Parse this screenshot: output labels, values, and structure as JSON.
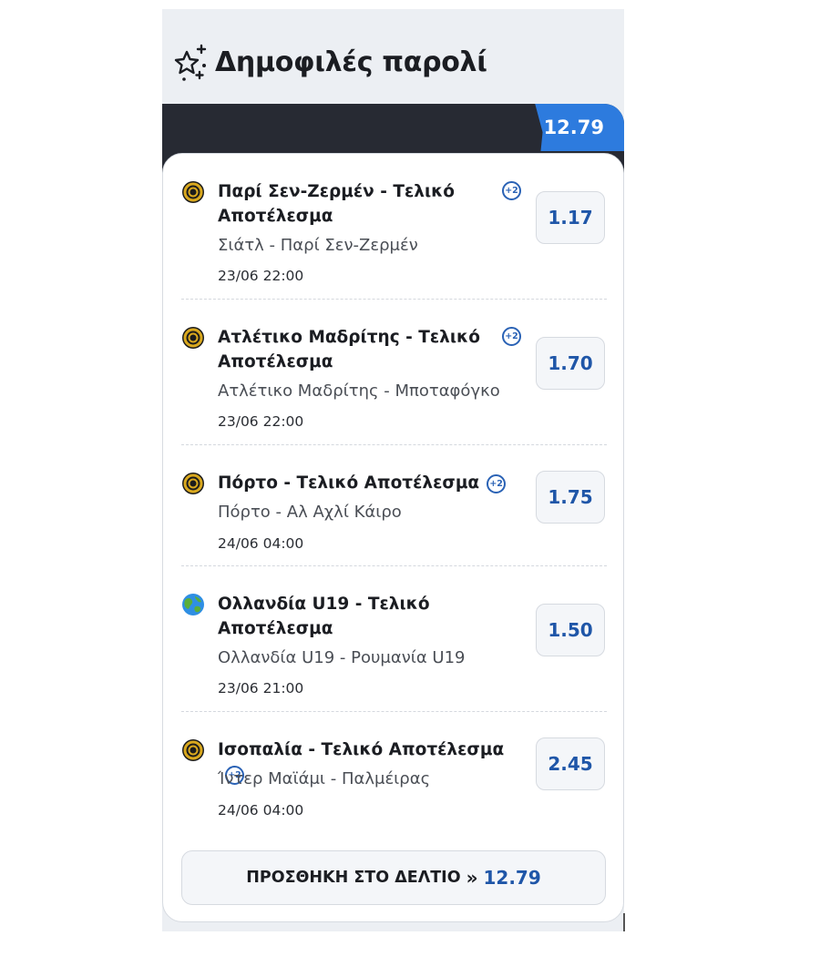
{
  "header": {
    "title": "Δημοφιλές παρολί",
    "icon": "sparkle-star-icon"
  },
  "total_odds": "12.79",
  "selections": [
    {
      "title": "Παρί Σεν-Ζερμέν - Τελικό Αποτέλεσμα",
      "title_line1": "Παρί Σεν-Ζερμέν - Τελικό",
      "title_line2": "Αποτέλεσμα",
      "badge": "+2",
      "match": "Σιάτλ - Παρί Σεν-Ζερμέν",
      "datetime": "23/06 22:00",
      "odds": "1.17",
      "icon": "football-ball-icon"
    },
    {
      "title": "Ατλέτικο Μαδρίτης - Τελικό Αποτέλεσμα",
      "title_line1": "Ατλέτικο Μαδρίτης - Τελικό",
      "title_line2": "Αποτέλεσμα",
      "badge": "+2",
      "match": "Ατλέτικο Μαδρίτης - Μποταφόγκο",
      "datetime": "23/06 22:00",
      "odds": "1.70",
      "icon": "football-ball-icon"
    },
    {
      "title": "Πόρτο - Τελικό Αποτέλεσμα",
      "badge": "+2",
      "match": "Πόρτο - Αλ Αχλί Κάιρο",
      "datetime": "24/06 04:00",
      "odds": "1.75",
      "icon": "football-ball-icon"
    },
    {
      "title": "Ολλανδία U19 - Τελικό Αποτέλεσμα",
      "title_line1": "Ολλανδία U19 - Τελικό",
      "title_line2": "Αποτέλεσμα",
      "match": "Ολλανδία U19 - Ρουμανία U19",
      "datetime": "23/06 21:00",
      "odds": "1.50",
      "icon": "globe-icon"
    },
    {
      "title": "Ισοπαλία - Τελικό Αποτέλεσμα",
      "badge": "+2",
      "match": "Ίντερ Μαϊάμι - Παλμέιρας",
      "datetime": "24/06 04:00",
      "odds": "2.45",
      "icon": "football-ball-icon"
    }
  ],
  "add_button": {
    "label": "ΠΡΟΣΘΗΚΗ ΣΤΟ ΔΕΛΤΙΟ",
    "arrows": "»",
    "total": "12.79"
  },
  "colors": {
    "accent_blue": "#2d7bde",
    "odds_text": "#1f56a8",
    "dark_bar": "#272a33",
    "panel_bg": "#eceff3"
  }
}
